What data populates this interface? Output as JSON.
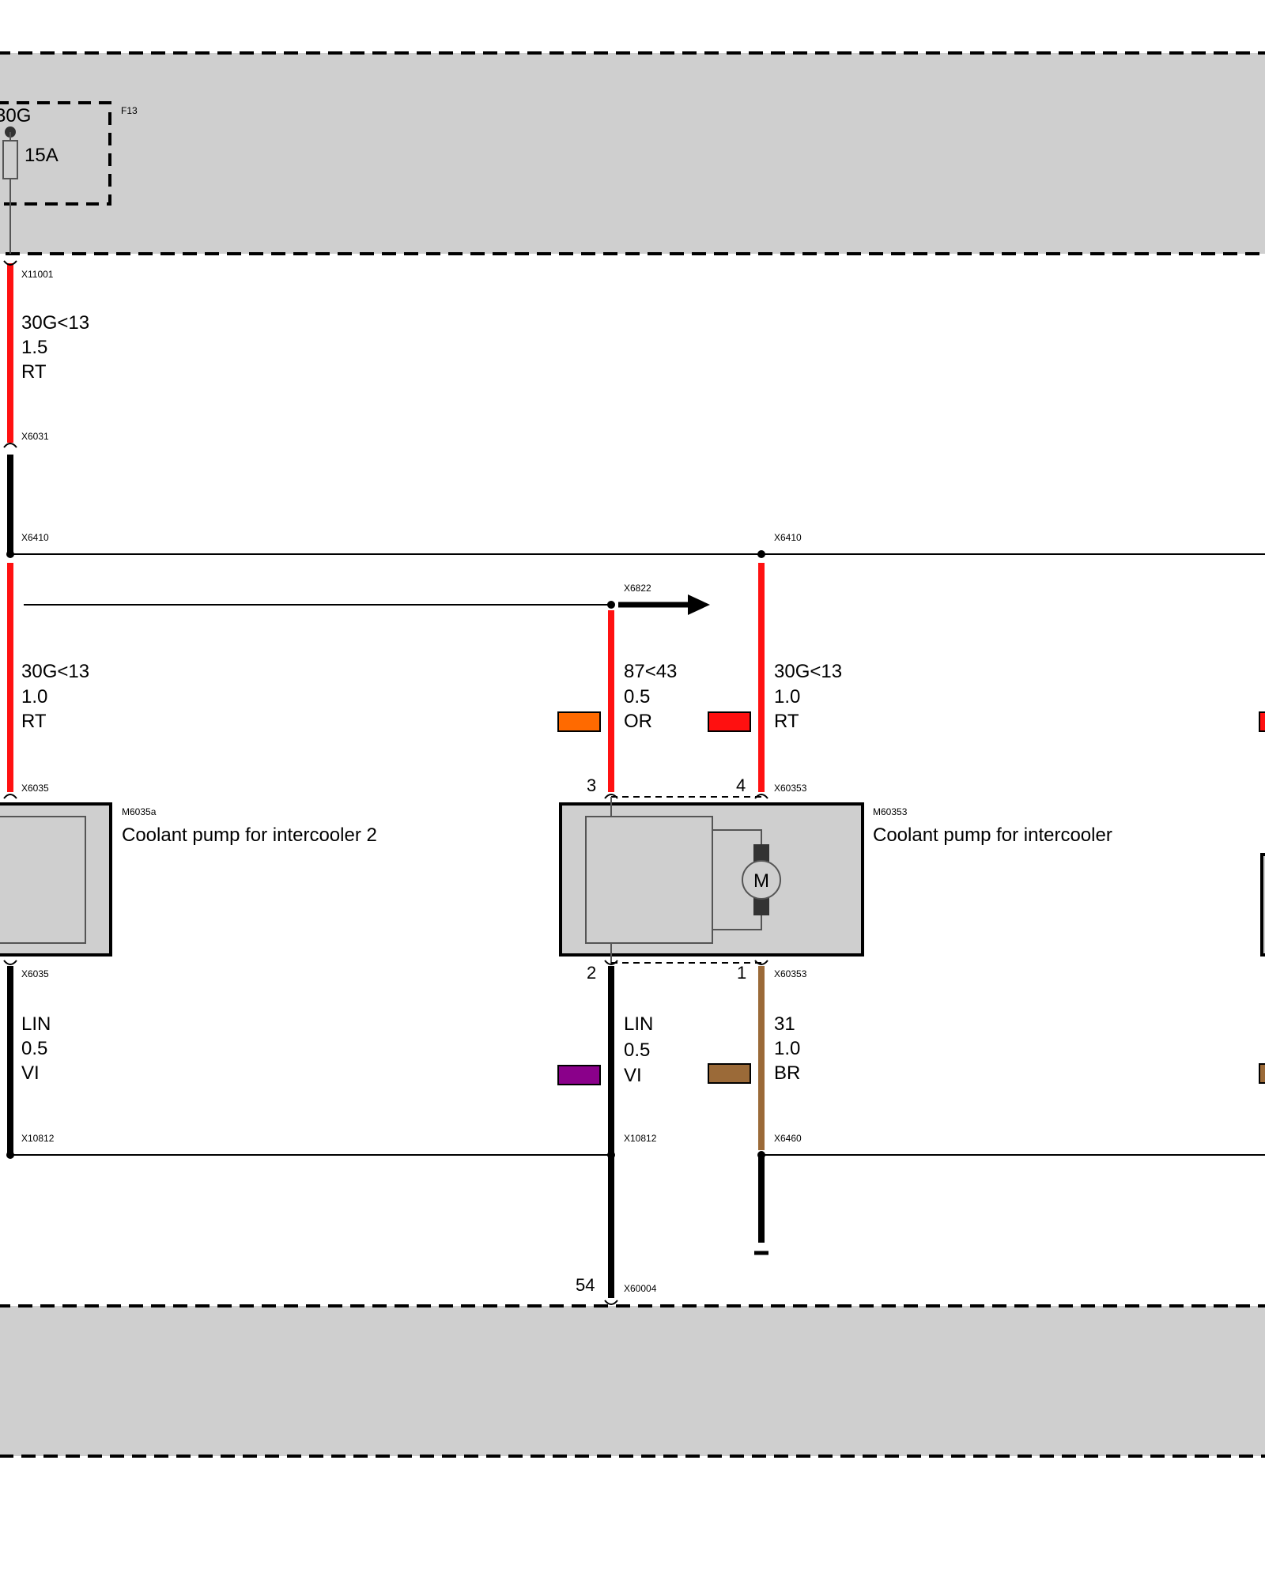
{
  "colors": {
    "panel": "#cfcfcf",
    "wire_red": "#ff1111",
    "wire_black": "#000000",
    "wire_brown": "#9b6a38",
    "swatch_orange": "#ff6a00",
    "swatch_red": "#ff1010",
    "swatch_violet": "#8a008a",
    "swatch_brown": "#9b6a38"
  },
  "fuse": {
    "ref": "F13",
    "terminal": "30G",
    "rating": "15A"
  },
  "connectors": {
    "x11001": "X11001",
    "x6031": "X6031",
    "x6410_left": "X6410",
    "x6410_right": "X6410",
    "x6822": "X6822",
    "x6035_top": "X6035",
    "x6035_bottom": "X6035",
    "x60353_top": "X60353",
    "x60353_bottom": "X60353",
    "x10812_left": "X10812",
    "x10812_mid": "X10812",
    "x6460": "X6460",
    "x60004": "X60004"
  },
  "wires": {
    "w1": {
      "signal": "30G<13",
      "size": "1.5",
      "color": "RT"
    },
    "w2": {
      "signal": "30G<13",
      "size": "1.0",
      "color": "RT"
    },
    "w3": {
      "signal": "87<43",
      "size": "0.5",
      "color": "OR"
    },
    "w4": {
      "signal": "30G<13",
      "size": "1.0",
      "color": "RT"
    },
    "w5": {
      "signal": "LIN",
      "size": "0.5",
      "color": "VI"
    },
    "w6": {
      "signal": "LIN",
      "size": "0.5",
      "color": "VI"
    },
    "w7": {
      "signal": "31",
      "size": "1.0",
      "color": "BR"
    }
  },
  "components": {
    "pump2": {
      "ref": "M6035a",
      "name": "Coolant pump for intercooler 2"
    },
    "pump1": {
      "ref": "M60353",
      "name": "Coolant pump for intercooler",
      "motor_symbol": "M"
    }
  },
  "pins": {
    "pin3": "3",
    "pin4": "4",
    "pin2": "2",
    "pin1": "1",
    "pin54": "54"
  }
}
